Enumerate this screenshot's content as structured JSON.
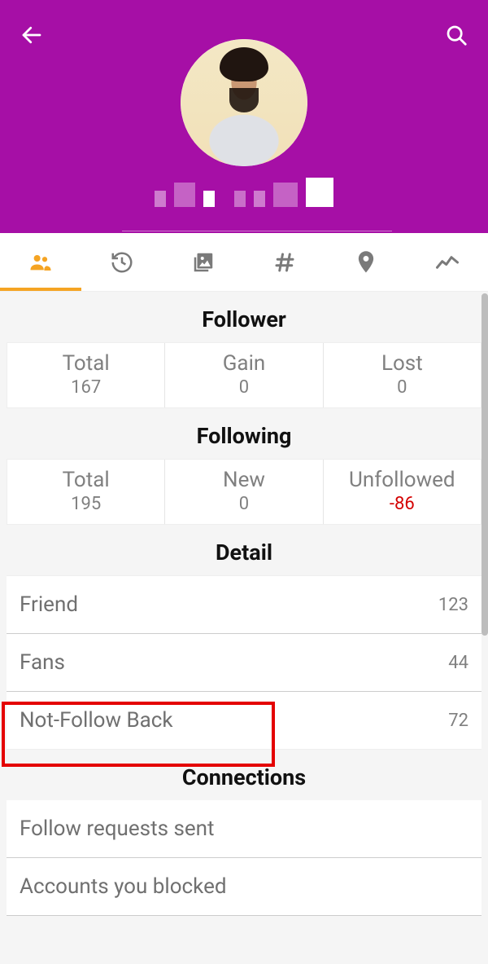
{
  "header": {
    "username_hidden": true
  },
  "tabs": {
    "items": [
      "people",
      "history",
      "photos",
      "hashtag",
      "location",
      "analytics"
    ],
    "active_index": 0
  },
  "follower": {
    "title": "Follower",
    "cols": [
      {
        "label": "Total",
        "value": "167"
      },
      {
        "label": "Gain",
        "value": "0"
      },
      {
        "label": "Lost",
        "value": "0"
      }
    ]
  },
  "following": {
    "title": "Following",
    "cols": [
      {
        "label": "Total",
        "value": "195"
      },
      {
        "label": "New",
        "value": "0"
      },
      {
        "label": "Unfollowed",
        "value": "-86",
        "neg": true
      }
    ]
  },
  "detail": {
    "title": "Detail",
    "rows": [
      {
        "label": "Friend",
        "value": "123"
      },
      {
        "label": "Fans",
        "value": "44"
      },
      {
        "label": "Not-Follow Back",
        "value": "72"
      }
    ]
  },
  "connections": {
    "title": "Connections",
    "rows": [
      {
        "label": "Follow requests sent"
      },
      {
        "label": "Accounts you blocked"
      }
    ]
  }
}
